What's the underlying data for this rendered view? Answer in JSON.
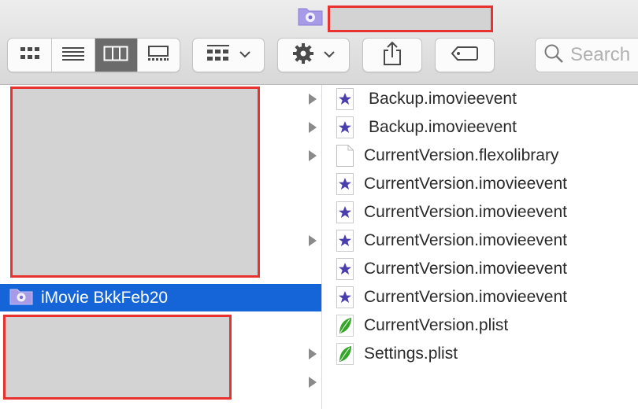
{
  "window": {
    "title_icon": "imovie-library-folder-icon"
  },
  "toolbar": {
    "view_icons": [
      "icon-view-icon",
      "list-view-icon",
      "column-view-icon",
      "gallery-view-icon"
    ],
    "active_view": "column",
    "group_icon": "group-by-icon",
    "action_icon": "gear-icon",
    "share_icon": "share-icon",
    "tag_icon": "tag-icon",
    "search_placeholder": "Search"
  },
  "sidebar": {
    "selected_item": {
      "label": "iMovie BkkFeb20",
      "icon": "imovie-library-folder-icon"
    }
  },
  "files": [
    {
      "name": "Backup.imovieevent",
      "icon": "imovie-event-star-icon"
    },
    {
      "name": "Backup.imovieevent",
      "icon": "imovie-event-star-icon"
    },
    {
      "name": "CurrentVersion.flexolibrary",
      "icon": "blank-document-icon"
    },
    {
      "name": "CurrentVersion.imovieevent",
      "icon": "imovie-event-star-icon"
    },
    {
      "name": "CurrentVersion.imovieevent",
      "icon": "imovie-event-star-icon"
    },
    {
      "name": "CurrentVersion.imovieevent",
      "icon": "imovie-event-star-icon"
    },
    {
      "name": "CurrentVersion.imovieevent",
      "icon": "imovie-event-star-icon"
    },
    {
      "name": "CurrentVersion.imovieevent",
      "icon": "imovie-event-star-icon"
    },
    {
      "name": "CurrentVersion.plist",
      "icon": "plist-leaf-icon"
    },
    {
      "name": "Settings.plist",
      "icon": "plist-leaf-icon"
    }
  ],
  "colors": {
    "selection": "#1565d8",
    "redaction_border": "#e8322f",
    "star": "#4b3fb0",
    "leaf": "#35a52a"
  }
}
